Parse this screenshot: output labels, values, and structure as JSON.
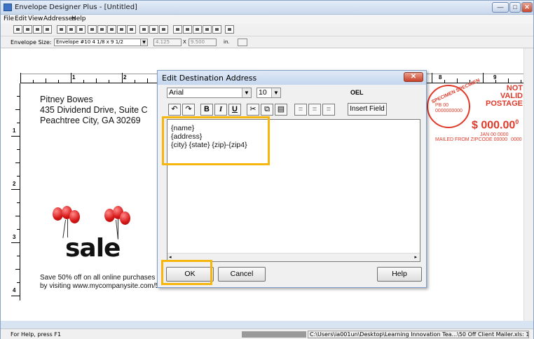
{
  "window": {
    "title": "Envelope Designer Plus - [Untitled]",
    "controls": {
      "minimize": "—",
      "maximize": "□",
      "close": "✕"
    }
  },
  "menu": [
    "File",
    "Edit",
    "View",
    "Addresses",
    "Help"
  ],
  "size_bar": {
    "label": "Envelope Size:",
    "envelope_size": "Envelope #10 4 1/8 x 9 1/2",
    "width": "4.125",
    "height": "9.500",
    "unit": "in."
  },
  "ruler": {
    "horizontal_labels": [
      "1",
      "2",
      "8",
      "9"
    ],
    "vertical_labels": [
      "1",
      "2",
      "3",
      "4"
    ]
  },
  "envelope": {
    "return_address": [
      "Pitney Bowes",
      "435 Dividend Drive, Suite C",
      "Peachtree City, GA 30269"
    ],
    "sale_word": "sale",
    "promo_lines": [
      "Save 50% off on all online purchases",
      "by visiting www.mycompanysite.com/5"
    ],
    "postage": {
      "seal_text": "SPECIMEN SPECIMEN",
      "notice": "NOT VALID POSTAGE",
      "amount": "$ 000.00",
      "amount_sup": "0",
      "line1_left": "PB 00",
      "line1_right": "JAN 00 0000",
      "line2_left": "0000000000",
      "line2_right": "0000",
      "line3": "MAILED FROM ZIPCODE 00000"
    }
  },
  "status_bar": {
    "help": "For Help, press F1",
    "path": "C:\\Users\\ia001un\\Desktop\\Learning Innovation Tea...\\50 Off Client Mailer.xls: 1 of 214"
  },
  "dialog": {
    "title": "Edit Destination Address",
    "font": "Arial",
    "font_size": "10",
    "insert_field_label": "Insert Field",
    "oel_label": "OEL",
    "editor_lines": [
      "{name}",
      "{address}",
      "{city} {state} {zip}-{zip4}"
    ],
    "ok_label": "OK",
    "cancel_label": "Cancel",
    "help_label": "Help"
  },
  "highlight_color": "#f7b60e",
  "postage_color": "#e03a2a"
}
